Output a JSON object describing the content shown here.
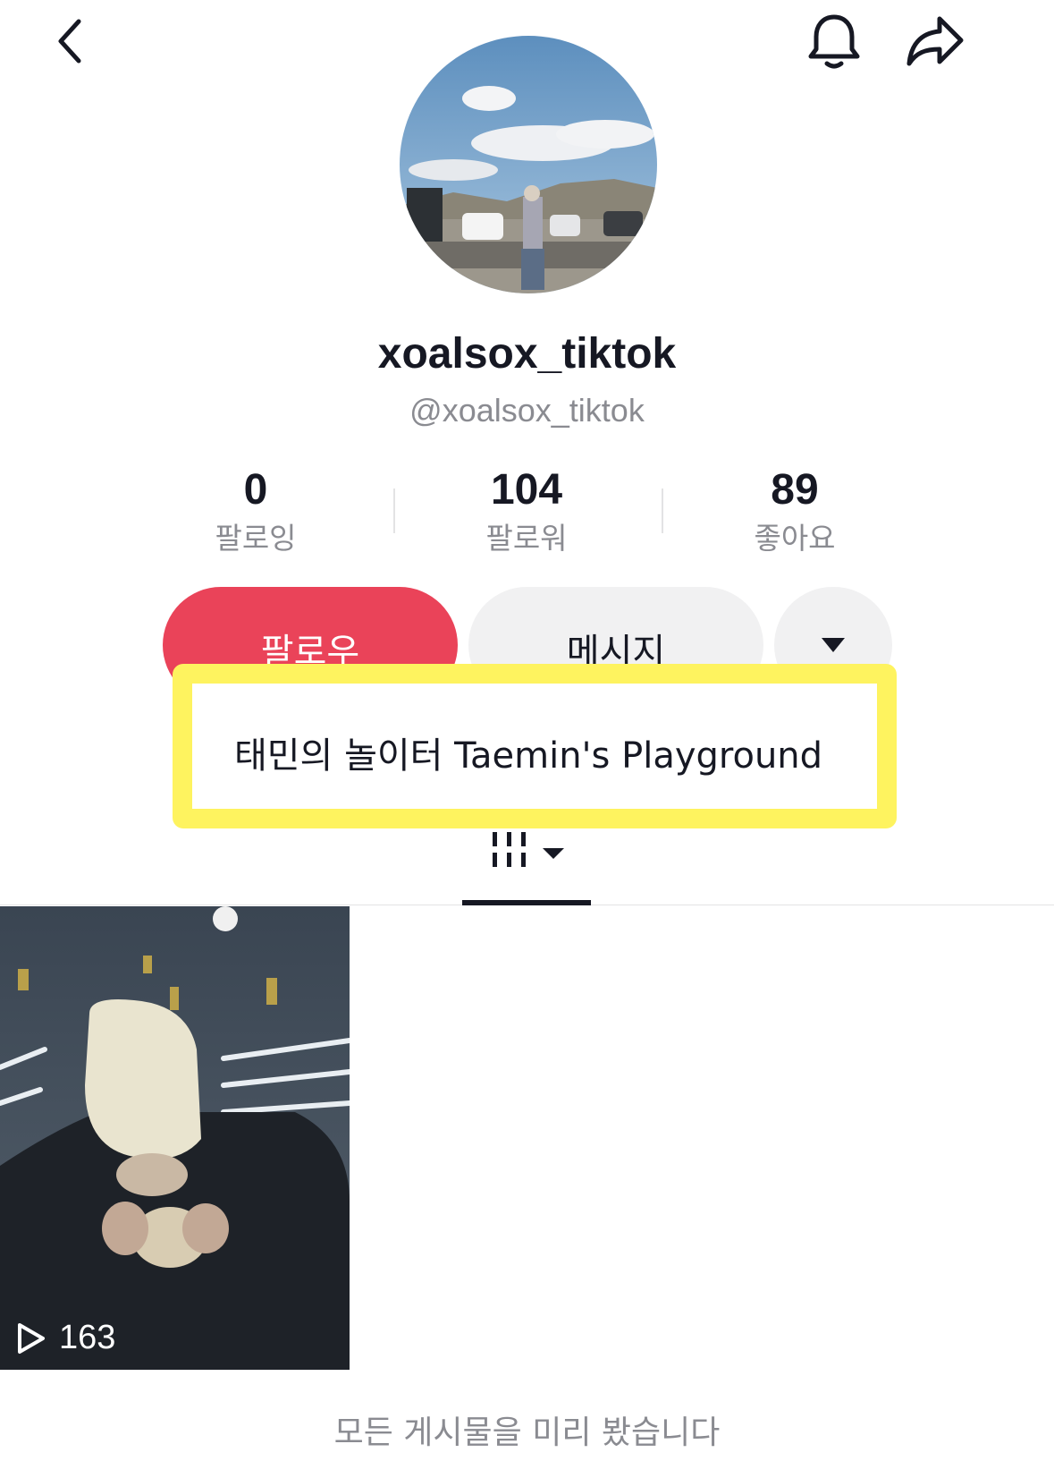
{
  "profile": {
    "display_name": "xoalsox_tiktok",
    "handle": "@xoalsox_tiktok",
    "bio": "태민의 놀이터 Taemin's Playground"
  },
  "stats": [
    {
      "value": "0",
      "label": "팔로잉"
    },
    {
      "value": "104",
      "label": "팔로워"
    },
    {
      "value": "89",
      "label": "좋아요"
    }
  ],
  "actions": {
    "follow_label": "팔로우",
    "message_label": "메시지"
  },
  "videos": [
    {
      "play_count": "163"
    }
  ],
  "footer": {
    "end_text": "모든 게시물을 미리 봤습니다"
  },
  "icons": {
    "back": "chevron-left-icon",
    "notification": "bell-icon",
    "share": "share-arrow-icon",
    "more": "caret-down-icon",
    "videos_tab": "grid-icon",
    "play": "play-icon"
  },
  "colors": {
    "follow": "#ea4359",
    "secondary_button": "#f1f1f2",
    "highlight": "#fef35f",
    "muted_text": "#8a8b91"
  }
}
